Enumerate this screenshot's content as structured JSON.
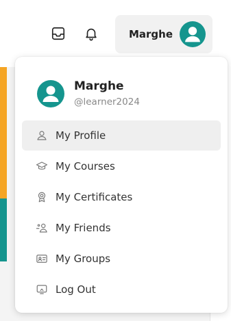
{
  "header": {
    "inbox_icon": "inbox-icon",
    "bell_icon": "bell-icon",
    "user_name": "Marghe"
  },
  "dropdown": {
    "name": "Marghe",
    "handle": "@learner2024",
    "items": [
      {
        "label": "My Profile",
        "icon": "user-icon",
        "active": true
      },
      {
        "label": "My Courses",
        "icon": "graduation-cap-icon"
      },
      {
        "label": "My Certificates",
        "icon": "award-badge-icon"
      },
      {
        "label": "My Friends",
        "icon": "friends-icon"
      },
      {
        "label": "My Groups",
        "icon": "id-card-icon"
      },
      {
        "label": "Log Out",
        "icon": "logout-screen-icon"
      }
    ]
  },
  "colors": {
    "accent_teal": "#15958e",
    "accent_orange": "#f5a524"
  }
}
